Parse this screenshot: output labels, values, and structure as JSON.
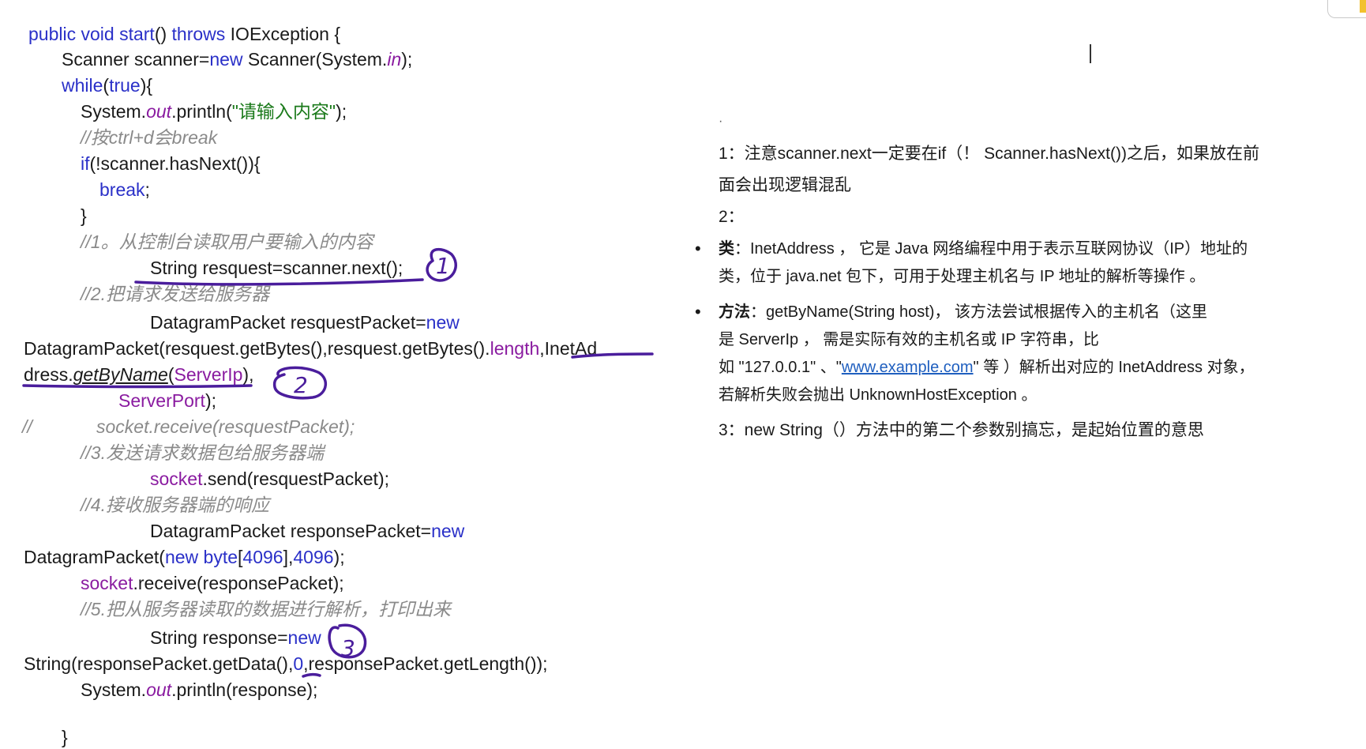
{
  "code": {
    "l01_a": "public void ",
    "l01_b": "start",
    "l01_c": "() ",
    "l01_d": "throws ",
    "l01_e": "IOException {",
    "l02_a": "Scanner scanner=",
    "l02_b": "new ",
    "l02_c": "Scanner(System.",
    "l02_d": "in",
    "l02_e": ");",
    "l03_a": "while",
    "l03_b": "(",
    "l03_c": "true",
    "l03_d": "){",
    "l04_a": "System.",
    "l04_b": "out",
    "l04_c": ".println(",
    "l04_d": "\"请输入内容\"",
    "l04_e": ");",
    "l05": "//按ctrl+d会break",
    "l06_a": "if",
    "l06_b": "(!scanner.hasNext()){",
    "l07": "break",
    "l07_b": ";",
    "l08": "}",
    "l09": "//1。从控制台读取用户要输入的内容",
    "l10": "String resquest=scanner.next();",
    "l11": "//2.把请求发送给服务器",
    "l12_a": "DatagramPacket resquestPacket=",
    "l12_b": "new",
    "l13_a": "DatagramPacket(resquest.getBytes(),resquest.getBytes().",
    "l13_b": "length",
    "l13_c": ",InetAd",
    "l14_a": "dress.",
    "l14_b": "getByName",
    "l14_c": "(",
    "l14_d": "ServerIp",
    "l14_e": "),",
    "l15_a": "ServerPort",
    "l15_b": ");",
    "l16_a": "//",
    "l16_b": "socket.receive(resquestPacket);",
    "l17": "//3.发送请求数据包给服务器端",
    "l18_a": "socket",
    "l18_b": ".send(resquestPacket);",
    "l19": "//4.接收服务器端的响应",
    "l20_a": "DatagramPacket responsePacket=",
    "l20_b": "new",
    "l21_a": "DatagramPacket(",
    "l21_b": "new byte",
    "l21_c": "[",
    "l21_d": "4096",
    "l21_e": "],",
    "l21_f": "4096",
    "l21_g": ");",
    "l22_a": "socket",
    "l22_b": ".receive(responsePacket);",
    "l23": "//5.把从服务器读取的数据进行解析，打印出来",
    "l24_a": "String response=",
    "l24_b": "new",
    "l25_a": "String(responsePacket.getData(),",
    "l25_b": "0",
    "l25_c": ",responsePacket.getLength());",
    "l26_a": "System.",
    "l26_b": "out",
    "l26_c": ".println(response);",
    "l27": "}"
  },
  "annotations": {
    "mark1": "1",
    "mark2": "2",
    "mark3": "3"
  },
  "notes": {
    "dot": "·",
    "n1_line1": "1：注意scanner.next一定要在if（！ Scanner.hasNext())之后，如果放在前",
    "n1_line2": "面会出现逻辑混乱",
    "n2": "2：",
    "b1_label": "类",
    "b1_line1": "：InetAddress ， 它是 Java 网络编程中用于表示互联网协议（IP）地址的",
    "b1_line2": "类，位于 java.net 包下，可用于处理主机名与 IP 地址的解析等操作 。",
    "b2_label": "方法",
    "b2_line1": "：getByName(String host)， 该方法尝试根据传入的主机名（这里",
    "b2_line2": "是 ServerIp ， 需是实际有效的主机名或 IP 字符串，比",
    "b2_line3_a": "如 \"127.0.0.1\" 、\"",
    "b2_line3_link": "www.example.com",
    "b2_line3_b": "\" 等 ）解析出对应的 InetAddress 对象，",
    "b2_line4": "若解析失败会抛出 UnknownHostException 。",
    "n3": "3：new String（）方法中的第二个参数别搞忘，是起始位置的意思"
  },
  "colors": {
    "ink": "#4a1d9c",
    "keyword": "#2a30c8",
    "string": "#1b7a1b",
    "field": "#8a1ba0",
    "comment": "#8a8a8a",
    "link": "#1f5fbf"
  }
}
